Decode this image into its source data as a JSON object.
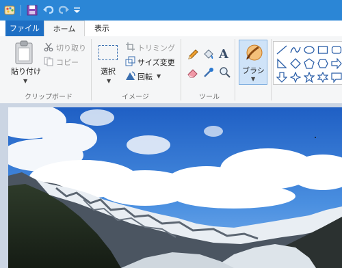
{
  "quick_access": {
    "app_icon": "paint-app-icon",
    "save_icon": "save-icon",
    "undo_icon": "undo-icon",
    "redo_icon": "redo-icon",
    "customize_icon": "customize-dropdown-icon"
  },
  "tabs": [
    {
      "label": "ファイル"
    },
    {
      "label": "ホーム"
    },
    {
      "label": "表示"
    }
  ],
  "clipboard": {
    "paste_label": "貼り付け",
    "cut_label": "切り取り",
    "copy_label": "コピー",
    "group_label": "クリップボード"
  },
  "image": {
    "select_label": "選択",
    "crop_label": "トリミング",
    "resize_label": "サイズ変更",
    "rotate_label": "回転",
    "group_label": "イメージ"
  },
  "tools": {
    "group_label": "ツール"
  },
  "brushes": {
    "label": "ブラシ"
  },
  "colors": {
    "titlebar": "#2b86d6",
    "file_tab": "#1e6fc4",
    "ribbon_bg": "#f5f6f7",
    "brush_selected": "#cfe3f8"
  }
}
